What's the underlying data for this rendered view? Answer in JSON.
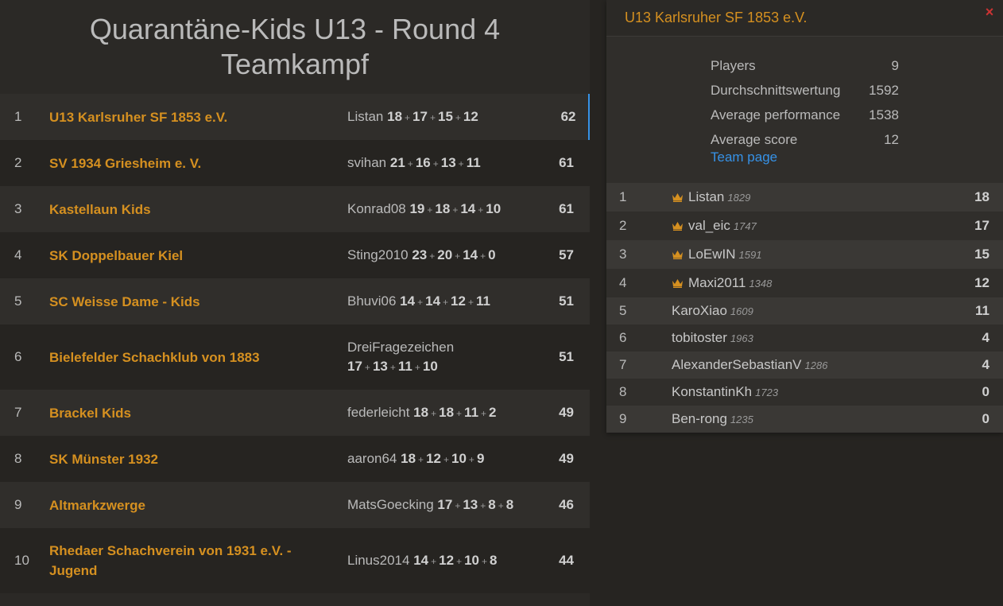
{
  "title": "Quarantäne-Kids U13 - Round 4 Teamkampf",
  "standings": [
    {
      "rank": "1",
      "team": "U13 Karlsruher SF 1853 e.V.",
      "leader": "Listan",
      "scores": [
        "18",
        "17",
        "15",
        "12"
      ],
      "total": "62"
    },
    {
      "rank": "2",
      "team": "SV 1934 Griesheim e. V.",
      "leader": "svihan",
      "scores": [
        "21",
        "16",
        "13",
        "11"
      ],
      "total": "61"
    },
    {
      "rank": "3",
      "team": "Kastellaun Kids",
      "leader": "Konrad08",
      "scores": [
        "19",
        "18",
        "14",
        "10"
      ],
      "total": "61"
    },
    {
      "rank": "4",
      "team": "SK Doppelbauer Kiel",
      "leader": "Sting2010",
      "scores": [
        "23",
        "20",
        "14",
        "0"
      ],
      "total": "57"
    },
    {
      "rank": "5",
      "team": "SC Weisse Dame - Kids",
      "leader": "Bhuvi06",
      "scores": [
        "14",
        "14",
        "12",
        "11"
      ],
      "total": "51"
    },
    {
      "rank": "6",
      "team": "Bielefelder Schachklub von 1883",
      "leader": "DreiFragezeichen",
      "scores": [
        "17",
        "13",
        "11",
        "10"
      ],
      "total": "51"
    },
    {
      "rank": "7",
      "team": "Brackel Kids",
      "leader": "federleicht",
      "scores": [
        "18",
        "18",
        "11",
        "2"
      ],
      "total": "49"
    },
    {
      "rank": "8",
      "team": "SK Münster 1932",
      "leader": "aaron64",
      "scores": [
        "18",
        "12",
        "10",
        "9"
      ],
      "total": "49"
    },
    {
      "rank": "9",
      "team": "Altmarkzwerge",
      "leader": "MatsGoecking",
      "scores": [
        "17",
        "13",
        "8",
        "8"
      ],
      "total": "46"
    },
    {
      "rank": "10",
      "team": "Rhedaer Schachverein von 1931 e.V. - Jugend",
      "leader": "Linus2014",
      "scores": [
        "14",
        "12",
        "10",
        "8"
      ],
      "total": "44"
    }
  ],
  "plus_sign": "+",
  "team_panel": {
    "name": "U13 Karlsruher SF 1853 e.V.",
    "close_icon": "×",
    "stats": [
      {
        "label": "Players",
        "value": "9"
      },
      {
        "label": "Durchschnittswertung",
        "value": "1592"
      },
      {
        "label": "Average performance",
        "value": "1538"
      },
      {
        "label": "Average score",
        "value": "12"
      }
    ],
    "team_page_link": "Team page",
    "players": [
      {
        "rank": "1",
        "name": "Listan",
        "rating": "1829",
        "score": "18",
        "top": true
      },
      {
        "rank": "2",
        "name": "val_eic",
        "rating": "1747",
        "score": "17",
        "top": true
      },
      {
        "rank": "3",
        "name": "LoEwIN",
        "rating": "1591",
        "score": "15",
        "top": true
      },
      {
        "rank": "4",
        "name": "Maxi2011",
        "rating": "1348",
        "score": "12",
        "top": true
      },
      {
        "rank": "5",
        "name": "KaroXiao",
        "rating": "1609",
        "score": "11",
        "top": false
      },
      {
        "rank": "6",
        "name": "tobitoster",
        "rating": "1963",
        "score": "4",
        "top": false
      },
      {
        "rank": "7",
        "name": "AlexanderSebastianV",
        "rating": "1286",
        "score": "4",
        "top": false
      },
      {
        "rank": "8",
        "name": "KonstantinKh",
        "rating": "1723",
        "score": "0",
        "top": false
      },
      {
        "rank": "9",
        "name": "Ben-rong",
        "rating": "1235",
        "score": "0",
        "top": false
      }
    ]
  },
  "colors": {
    "accent": "#3692e7",
    "team": "#d59020",
    "close": "#cc3333"
  }
}
